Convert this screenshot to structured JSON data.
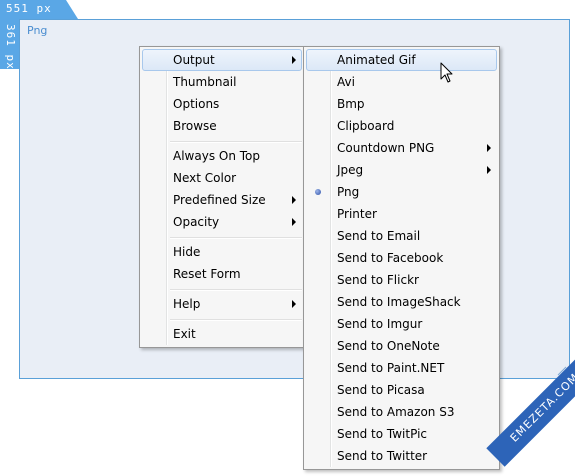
{
  "frame": {
    "width_label": "551 px",
    "height_label": "361 px",
    "format_label": "Png"
  },
  "main_menu": {
    "items": [
      {
        "label": "Output",
        "submenu": true,
        "highlighted": true
      },
      {
        "label": "Thumbnail"
      },
      {
        "label": "Options"
      },
      {
        "label": "Browse"
      },
      {
        "separator": true
      },
      {
        "label": "Always On Top"
      },
      {
        "label": "Next Color"
      },
      {
        "label": "Predefined Size",
        "submenu": true
      },
      {
        "label": "Opacity",
        "submenu": true
      },
      {
        "separator": true
      },
      {
        "label": "Hide"
      },
      {
        "label": "Reset Form"
      },
      {
        "separator": true
      },
      {
        "label": "Help",
        "submenu": true
      },
      {
        "separator": true
      },
      {
        "label": "Exit"
      }
    ]
  },
  "output_menu": {
    "items": [
      {
        "label": "Animated Gif",
        "highlighted": true
      },
      {
        "label": "Avi"
      },
      {
        "label": "Bmp"
      },
      {
        "label": "Clipboard"
      },
      {
        "label": "Countdown PNG",
        "submenu": true
      },
      {
        "label": "Jpeg",
        "submenu": true
      },
      {
        "label": "Png",
        "selected": true
      },
      {
        "label": "Printer"
      },
      {
        "label": "Send to Email"
      },
      {
        "label": "Send to Facebook"
      },
      {
        "label": "Send to Flickr"
      },
      {
        "label": "Send to ImageShack"
      },
      {
        "label": "Send to Imgur"
      },
      {
        "label": "Send to OneNote"
      },
      {
        "label": "Send to Paint.NET"
      },
      {
        "label": "Send to Picasa"
      },
      {
        "label": "Send to Amazon S3"
      },
      {
        "label": "Send to TwitPic"
      },
      {
        "label": "Send to Twitter"
      }
    ]
  },
  "watermark": "EMEZETA.COM",
  "colors": {
    "frame_border": "#5aa0d8",
    "frame_fill": "#e9eef6",
    "tab_fill": "#5aa7e6",
    "highlight": "#dce8f7",
    "watermark": "#2d64b8"
  }
}
